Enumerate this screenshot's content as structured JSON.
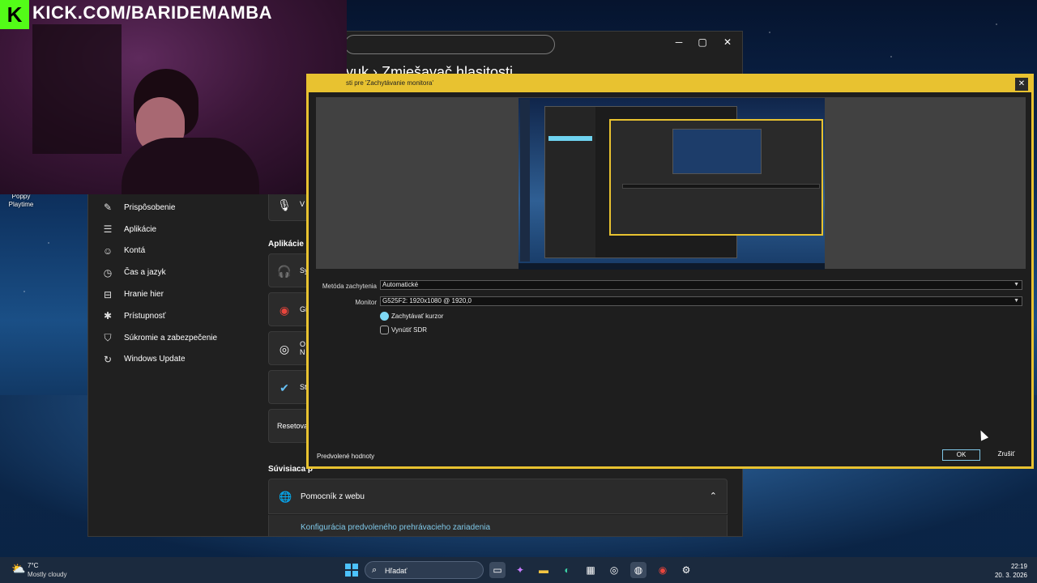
{
  "stream": {
    "brand_letter": "K",
    "url": "KICK.COM/BARIDEMAMBA"
  },
  "desktop": {
    "icon_label": "Poppy Playtime"
  },
  "settings": {
    "breadcrumb": "vuk  ›  Zmiešavač hlasitosti",
    "nav": [
      {
        "label": "Prispôsobenie",
        "icon": "pencil-icon"
      },
      {
        "label": "Aplikácie",
        "icon": "apps-icon"
      },
      {
        "label": "Kontá",
        "icon": "person-icon"
      },
      {
        "label": "Čas a jazyk",
        "icon": "clock-globe-icon"
      },
      {
        "label": "Hranie hier",
        "icon": "gamepad-icon"
      },
      {
        "label": "Prístupnosť",
        "icon": "accessibility-icon"
      },
      {
        "label": "Súkromie a zabezpečenie",
        "icon": "shield-icon"
      },
      {
        "label": "Windows Update",
        "icon": "update-icon"
      }
    ],
    "input_card_text": "V",
    "apps_section_title": "Aplikácie",
    "app_cards": [
      {
        "icon": "headphones-icon",
        "text": "Sy"
      },
      {
        "icon": "chrome-icon",
        "text": "Gi"
      },
      {
        "icon": "obs-icon",
        "text": "O\nN"
      },
      {
        "icon": "steam-icon",
        "text": "St"
      }
    ],
    "reset_card_text": "Resetova",
    "related_title": "Súvisiaca p",
    "web_help": "Pomocník z webu",
    "web_link": "Konfigurácia predvoleného prehrávacieho zariadenia"
  },
  "obs": {
    "title": "sti pre 'Zachytávanie monitora'",
    "capture_method_label": "Metóda zachytenia",
    "capture_method_value": "Automatické",
    "monitor_label": "Monitor",
    "monitor_value": "G525F2: 1920x1080 @ 1920,0",
    "capture_cursor": {
      "label": "Zachytávať kurzor",
      "checked": true
    },
    "force_sdr": {
      "label": "Vynútiť SDR",
      "checked": false
    },
    "defaults_button": "Predvolené hodnoty",
    "ok_button": "OK",
    "cancel_button": "Zrušiť"
  },
  "taskbar": {
    "weather_temp": "7°C",
    "weather_desc": "Mostly cloudy",
    "search_placeholder": "Hľadať",
    "time": "22:19",
    "date": "20. 3. 2026"
  },
  "colors": {
    "obs_accent": "#e8c230",
    "kick_green": "#53fc18",
    "win_accent": "#4cc2ff"
  }
}
